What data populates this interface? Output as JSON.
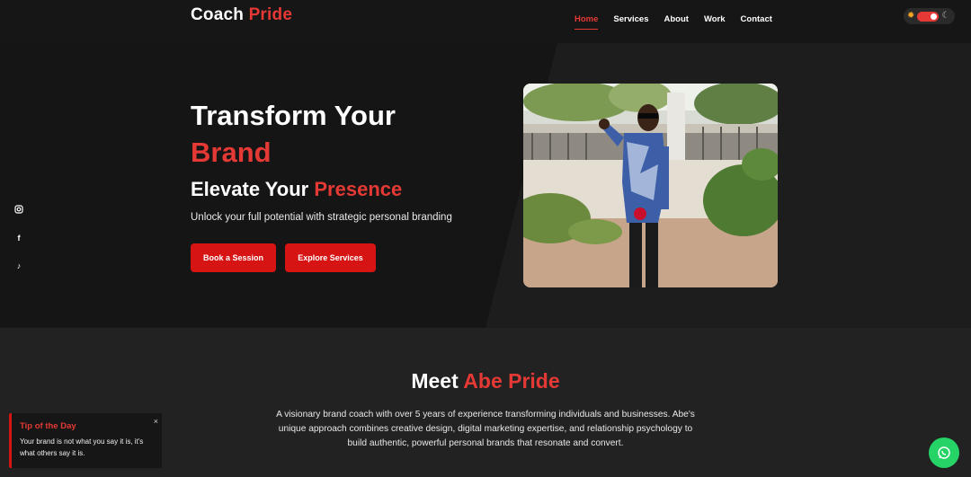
{
  "brand": {
    "name": "Coach",
    "accent": "Pride"
  },
  "nav": {
    "items": [
      {
        "label": "Home",
        "active": true
      },
      {
        "label": "Services"
      },
      {
        "label": "About"
      },
      {
        "label": "Work"
      },
      {
        "label": "Contact"
      }
    ]
  },
  "theme_toggle": {
    "sun_icon": "sun-icon",
    "moon_icon": "moon-icon",
    "state": "on"
  },
  "hero": {
    "title_line1": "Transform Your",
    "title_line2": "Brand",
    "subtitle": "Elevate Your",
    "subtitle_accent": "Presence",
    "tagline": "Unlock your full potential with strategic personal branding",
    "book_button": "Book a Session",
    "explore_button": "Explore Services"
  },
  "social": [
    "instagram-icon",
    "facebook-icon",
    "tiktok-icon"
  ],
  "about": {
    "title": "Meet",
    "title_accent": "Abe Pride",
    "description": "A visionary brand coach with over 5 years of experience transforming individuals and businesses. Abe's unique approach combines creative design, digital marketing expertise, and relationship psychology to build authentic, powerful personal brands that resonate and convert."
  },
  "tip": {
    "title": "Tip of the Day",
    "text": "Your brand is not what you say it is, it's what others say it is.",
    "close": "×"
  },
  "colors": {
    "accent": "#e53935",
    "button": "#d71414",
    "whatsapp": "#25d366"
  }
}
